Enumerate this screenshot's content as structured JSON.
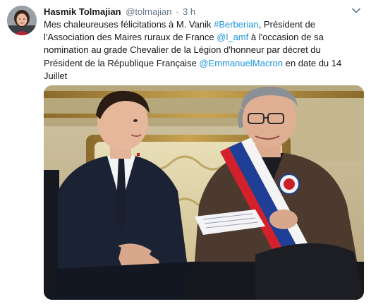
{
  "tweet": {
    "author_name": "Hasmik Tolmajian",
    "author_handle": "@tolmajian",
    "separator": "·",
    "timestamp": "3 h",
    "icons": {
      "menu": "chevron-down-icon"
    },
    "text": {
      "part1": "Mes chaleureuses félicitations à M. Vanik ",
      "hashtag": "#Berberian",
      "part2": ", Président de l'Association des Maires ruraux de France ",
      "mention1": "@l_amf",
      "part3": " à l'occasion de sa nomination au grade Chevalier de la Légion d'honneur par décret du Président de la République Française ",
      "mention2": "@EmmanuelMacron",
      "part4": " en date du 14 Juillet"
    },
    "colors": {
      "link": "#1b95e0",
      "text": "#14171a",
      "secondary": "#657786"
    }
  }
}
